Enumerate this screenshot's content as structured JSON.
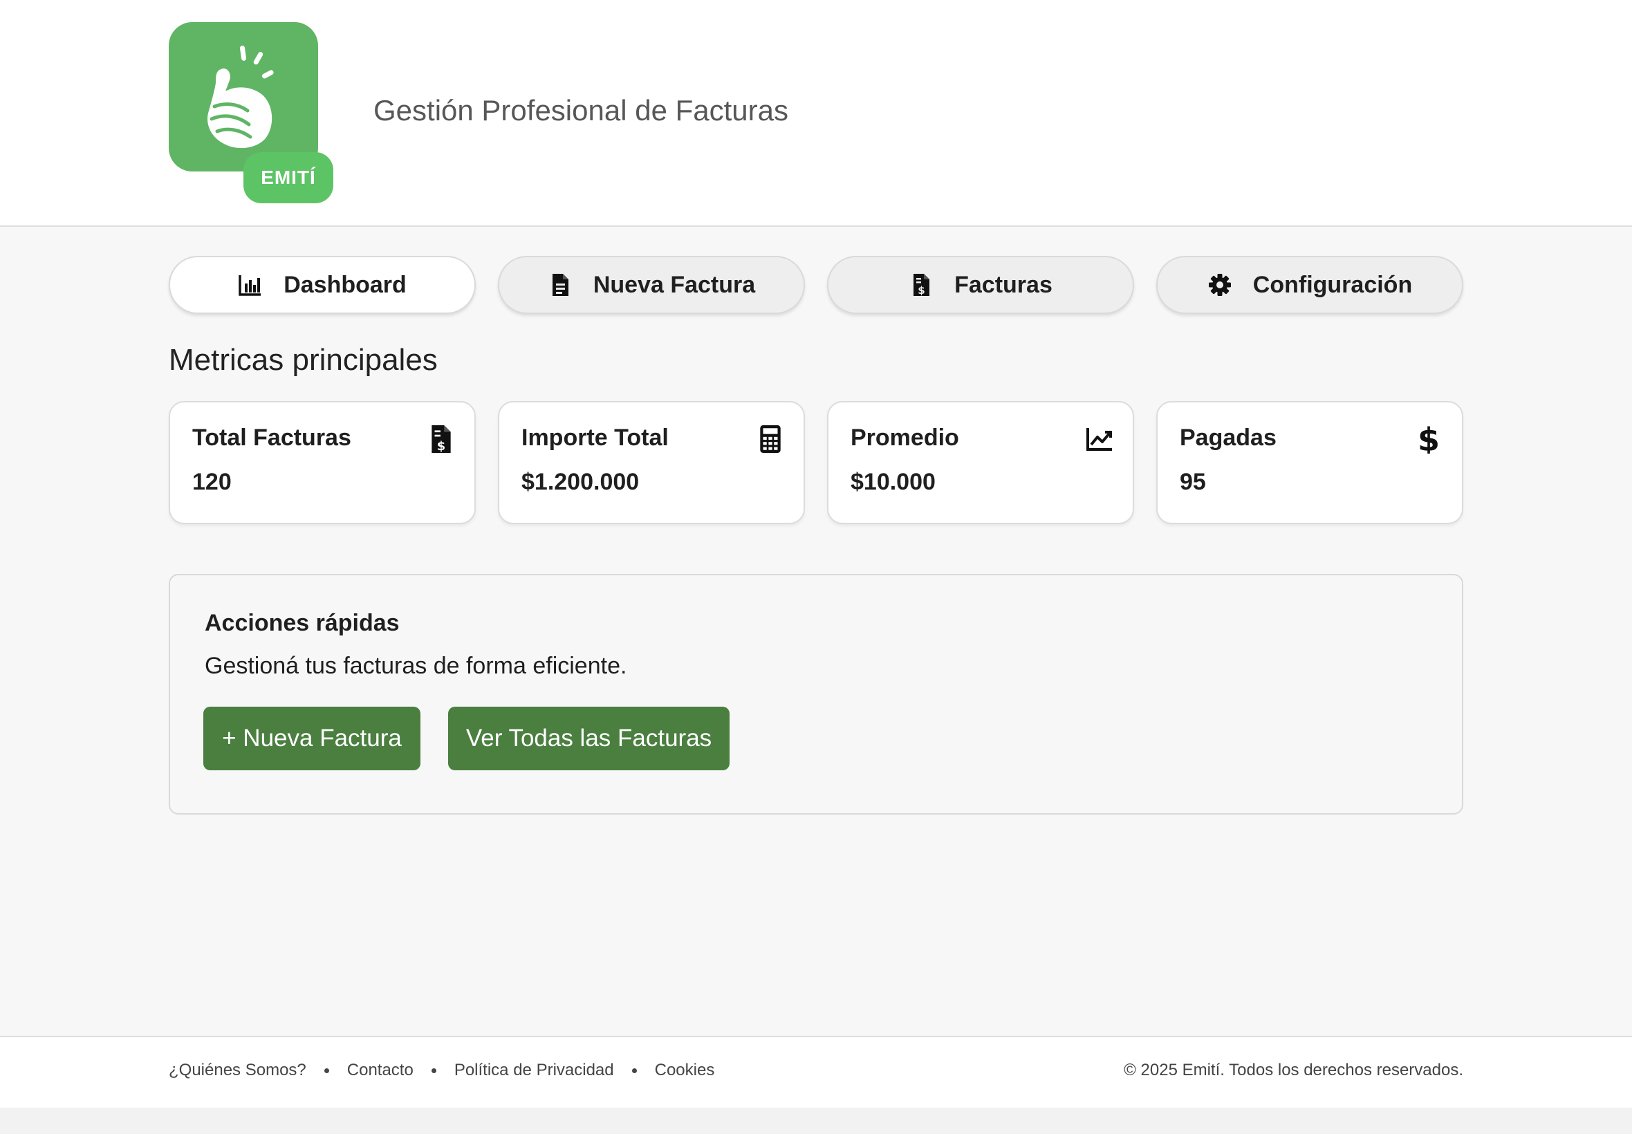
{
  "header": {
    "logo_text": "EMITÍ",
    "tagline": "Gestión Profesional de Facturas"
  },
  "nav": {
    "items": [
      {
        "label": "Dashboard",
        "icon": "bar-chart-icon",
        "active": true
      },
      {
        "label": "Nueva Factura",
        "icon": "document-icon",
        "active": false
      },
      {
        "label": "Facturas",
        "icon": "invoice-dollar-icon",
        "active": false
      },
      {
        "label": "Configuración",
        "icon": "gear-icon",
        "active": false
      }
    ]
  },
  "main": {
    "section_title": "Metricas principales",
    "metrics": [
      {
        "label": "Total Facturas",
        "value": "120",
        "icon": "invoice-dollar-icon"
      },
      {
        "label": "Importe Total",
        "value": "$1.200.000",
        "icon": "calculator-icon"
      },
      {
        "label": "Promedio",
        "value": "$10.000",
        "icon": "line-chart-icon"
      },
      {
        "label": "Pagadas",
        "value": "95",
        "icon": "dollar-icon"
      }
    ],
    "quick_actions": {
      "title": "Acciones rápidas",
      "subtitle": "Gestioná tus facturas de forma eficiente.",
      "new_invoice_label": "+ Nueva Factura",
      "view_all_label": "Ver Todas las Facturas"
    }
  },
  "footer": {
    "links": [
      "¿Quiénes Somos?",
      "Contacto",
      "Política de Privacidad",
      "Cookies"
    ],
    "copyright": "© 2025 Emití. Todos los derechos reservados."
  },
  "colors": {
    "brand_green": "#5fb564",
    "badge_green": "#5dc466",
    "button_green": "#4a7f40"
  }
}
